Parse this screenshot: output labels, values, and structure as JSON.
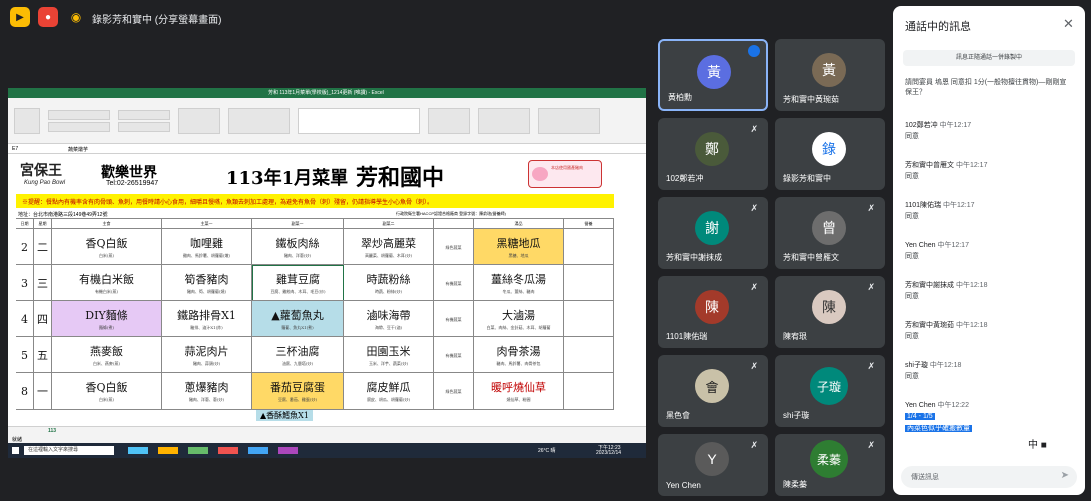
{
  "topbar": {
    "title": "錄影芳和實中 (分享螢幕畫面)",
    "accent_yellow": "#fbbc04",
    "accent_red": "#ea4335"
  },
  "excel": {
    "window_title": "芳和 113年1月菜單(學校版)_1214更新 (唯讀) - Excel",
    "cell_ref": "E7",
    "formula": "蔬菜燉芋",
    "sheet_tab": "113",
    "status": "就緒"
  },
  "menu": {
    "vendor_name": "宮保王",
    "vendor_sub": "Kung Pao Bowl",
    "happy_world": "歡樂世界",
    "tel": "Tel:02-26519947",
    "title": "113年1月菜單",
    "school": "芳和國中",
    "logo_text": "本店使用國產豬肉",
    "notice": "※提醒：餐點內有機率含有肉骨頭、魚刺，用餐時請小心食用，細嚼且慢嚥，魚類去刺加工處理，為避免有魚骨（刺）殘留，仍請指導學生小心魚骨（刺）。",
    "address": "地址：台北市南港路三段149巷49弄12號",
    "license": "行政院衛生署HACCP認證合格廠商 登錄字號：陳俞瑄(營養師)",
    "headers": [
      "日期",
      "星期",
      "主食",
      "主菜一",
      "副菜一",
      "副菜二",
      "湯品",
      "營養"
    ],
    "rows": [
      {
        "date": "2",
        "day": "二",
        "staple": "香Q白飯",
        "staple_sub": "白米(蒸)",
        "main": "咖哩雞",
        "main_sub": "雞肉、馬鈴薯、胡蘿蔔(燉)",
        "side1": "鐵板肉絲",
        "side1_sub": "豬肉、洋蔥(炒)",
        "side2": "翠炒高麗菜",
        "side2_sub": "高麗菜、胡蘿蔔、木耳(炒)",
        "veg": "綠色蔬菜",
        "soup": "黑糖地瓜",
        "soup_sub": "黑糖、地瓜"
      },
      {
        "date": "3",
        "day": "三",
        "staple": "有機白米飯",
        "staple_sub": "有機白米(蒸)",
        "main": "筍香豬肉",
        "main_sub": "豬肉、筍、胡蘿蔔(燒)",
        "side1": "雞茸豆腐",
        "side1_sub": "豆腐、雞絞肉、木耳、毛豆(炒)",
        "side2": "時蔬粉絲",
        "side2_sub": "時蔬、粉絲(炒)",
        "veg": "有機蔬菜",
        "soup": "薑絲冬瓜湯",
        "soup_sub": "冬瓜、薑絲、豬肉"
      },
      {
        "date": "4",
        "day": "四",
        "staple": "DIY麵條",
        "staple_sub": "麵條(煮)",
        "main": "鐵路排骨X1",
        "main_sub": "豬排、滷汁X1(炸)",
        "side1": "▲蘿蔔魚丸",
        "side1_sub": "蘿蔔、魚丸X1(煮)",
        "side2": "滷味海帶",
        "side2_sub": "海帶、豆干(滷)",
        "veg": "有機蔬菜",
        "soup": "大滷湯",
        "soup_sub": "白菜、肉絲、金針菇、木耳、胡蘿蔔"
      },
      {
        "date": "5",
        "day": "五",
        "staple": "燕麥飯",
        "staple_sub": "白米、燕麥(蒸)",
        "main": "蒜泥肉片",
        "main_sub": "豬肉、蒜頭(炒)",
        "side1": "三杯油腐",
        "side1_sub": "油腐、九層塔(炒)",
        "side2": "田園玉米",
        "side2_sub": "玉米、洋芋、蔬菜(炒)",
        "veg": "有機蔬菜",
        "soup": "肉骨茶湯",
        "soup_sub": "豬肉、馬鈴薯、肉骨茶包"
      },
      {
        "date": "8",
        "day": "一",
        "staple": "香Q白飯",
        "staple_sub": "白米(蒸)",
        "main": "蔥爆豬肉",
        "main_sub": "豬肉、洋蔥、蔥(炒)",
        "side1": "番茄豆腐蛋",
        "side1_sub": "豆腐、番茄、雞蛋(炒)",
        "side2": "腐皮鮮瓜",
        "side2_sub": "腐皮、胡瓜、胡蘿蔔(炒)",
        "veg": "綠色蔬菜",
        "soup": "暖呼燒仙草",
        "soup_sub": "燒仙草、粉圓"
      }
    ],
    "partial_row": "▲香酥鱈魚X1"
  },
  "taskbar": {
    "search_placeholder": "在這裡輸入文字來搜尋",
    "weather": "26°C 晴",
    "time": "下午12:23",
    "date": "2023/12/14"
  },
  "participants": [
    {
      "name": "黃柏勳",
      "initial": "黃",
      "color": "#5b6ee1"
    },
    {
      "name": "芳和實中黃琬茹",
      "initial": "黃",
      "color": "#7a6a55"
    },
    {
      "name": "102鄭若冲",
      "initial": "鄭",
      "color": "#4a5a3a"
    },
    {
      "name": "錄影芳和實中",
      "initial": "錄",
      "color": "#1a73e8"
    },
    {
      "name": "芳和實中謝抹成",
      "initial": "謝",
      "color": "#00897b"
    },
    {
      "name": "芳和實中曾雁文",
      "initial": "曾",
      "color": "#6d6d6d"
    },
    {
      "name": "1101陳佑瑞",
      "initial": "陳",
      "color": "#a33a2a"
    },
    {
      "name": "陳宥珢",
      "initial": "陳",
      "color": "#d9c9c0"
    },
    {
      "name": "黑色會",
      "initial": "會",
      "color": "#c9c1a8"
    },
    {
      "name": "shi子璇",
      "initial": "子璇",
      "color": "#00897b"
    },
    {
      "name": "Yen Chen",
      "initial": "Y",
      "color": "#5a5a5a"
    },
    {
      "name": "陳柔蓁",
      "initial": "柔蓁",
      "color": "#2e7d32"
    }
  ],
  "chat": {
    "title": "通話中的訊息",
    "saved_notice": "訊息正隨通話一併錄製中",
    "question": "請問宴員 塢恩 同意扣 1分(一般物擅往貫物)—剛剛宣保王？",
    "messages": [
      {
        "name": "102鄭若冲",
        "time": "中午12:17",
        "text": "同意"
      },
      {
        "name": "芳和實中曾雁文",
        "time": "中午12:17",
        "text": "同意"
      },
      {
        "name": "1101陳佑瑞",
        "time": "中午12:17",
        "text": "同意"
      },
      {
        "name": "Yen Chen",
        "time": "中午12:17",
        "text": "同意"
      },
      {
        "name": "芳和實中謝抹成",
        "time": "中午12:18",
        "text": "同意"
      },
      {
        "name": "芳和實中黃琬茹",
        "time": "中午12:18",
        "text": "同意"
      },
      {
        "name": "shi子璇",
        "time": "中午12:18",
        "text": "同意"
      },
      {
        "name": "Yen Chen",
        "time": "中午12:22",
        "text": "1/4 - 1/5"
      }
    ],
    "selected_text": "內菜色似乎確搬數量",
    "ime": "中",
    "input_placeholder": "傳送訊息"
  }
}
